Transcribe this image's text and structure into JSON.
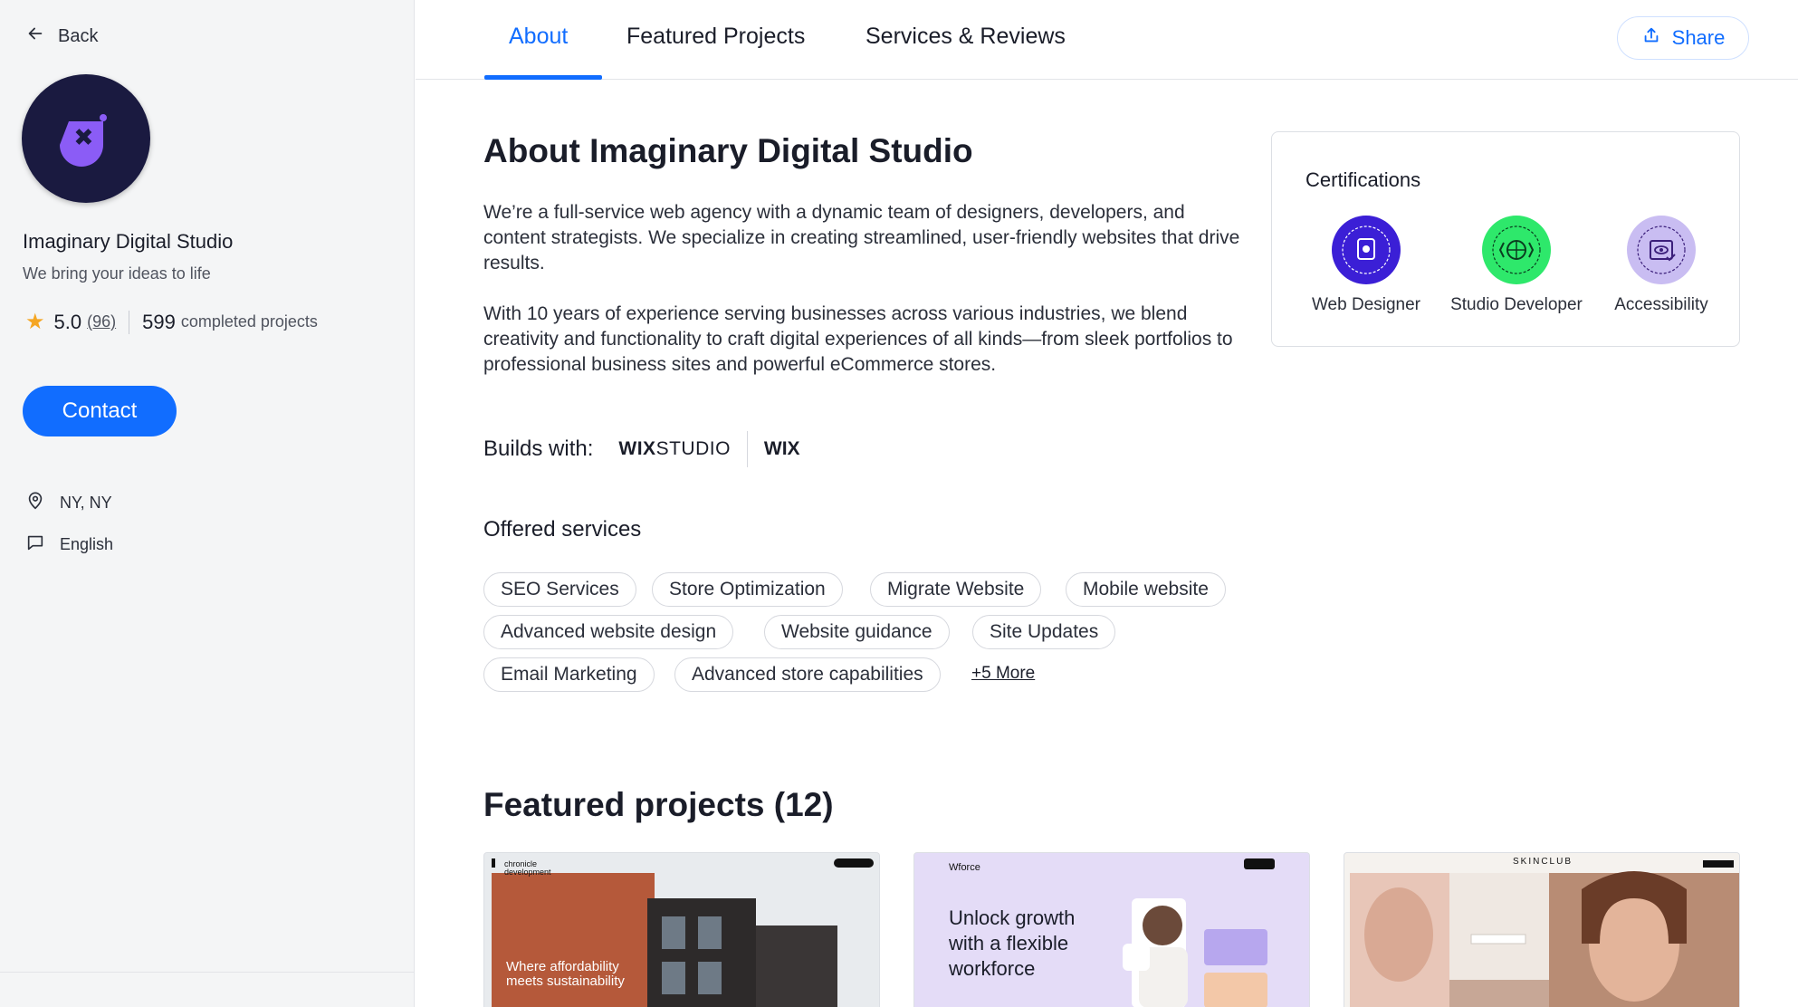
{
  "sidebar": {
    "back_label": "Back",
    "studio_name": "Imaginary Digital Studio",
    "tagline": "We bring your ideas to life",
    "rating": "5.0",
    "review_count": "(96)",
    "completed_count": "599",
    "completed_label": "completed projects",
    "contact_label": "Contact",
    "location": "NY, NY",
    "language": "English"
  },
  "tabs": {
    "items": [
      {
        "label": "About",
        "active": true
      },
      {
        "label": "Featured Projects",
        "active": false
      },
      {
        "label": "Services & Reviews",
        "active": false
      }
    ],
    "share_label": "Share"
  },
  "about": {
    "title": "About Imaginary Digital Studio",
    "paragraphs": [
      "We’re a full-service web agency with a dynamic team of designers, developers, and content strategists. We specialize in creating streamlined, user-friendly websites that drive results.",
      "With 10 years of experience serving businesses across various industries, we blend creativity and functionality to craft digital experiences of all kinds—from sleek portfolios to professional business sites and powerful eCommerce stores."
    ],
    "builds_with_label": "Builds with:",
    "platforms": [
      "WIX",
      "STUDIO",
      "WIX"
    ]
  },
  "services": {
    "title": "Offered services",
    "chips": [
      "SEO Services",
      "Store Optimization",
      "Migrate Website",
      "Mobile website",
      "Advanced website design",
      "Website guidance",
      "Site Updates",
      "Email Marketing",
      "Advanced store capabilities"
    ],
    "more_label": "+5 More"
  },
  "certifications": {
    "title": "Certifications",
    "items": [
      {
        "label": "Web Designer",
        "color": "#3b1fd6",
        "icon": "web-designer-badge-icon"
      },
      {
        "label": "Studio Developer",
        "color": "#2ee86b",
        "icon": "studio-developer-badge-icon"
      },
      {
        "label": "Accessibility",
        "color": "#c9bdf2",
        "icon": "accessibility-badge-icon"
      }
    ]
  },
  "featured": {
    "title": "Featured projects (12)",
    "projects": [
      {
        "brand": "chronicle development",
        "headline": "Where affordability meets sustainability"
      },
      {
        "brand": "Wforce",
        "headline": "Unlock growth with a flexible workforce"
      },
      {
        "brand": "SKINCLUB",
        "headline": ""
      }
    ]
  },
  "colors": {
    "accent": "#116dff",
    "star": "#f5a623",
    "avatar_bg": "#1a1a40",
    "avatar_mark": "#8b5cf6"
  }
}
